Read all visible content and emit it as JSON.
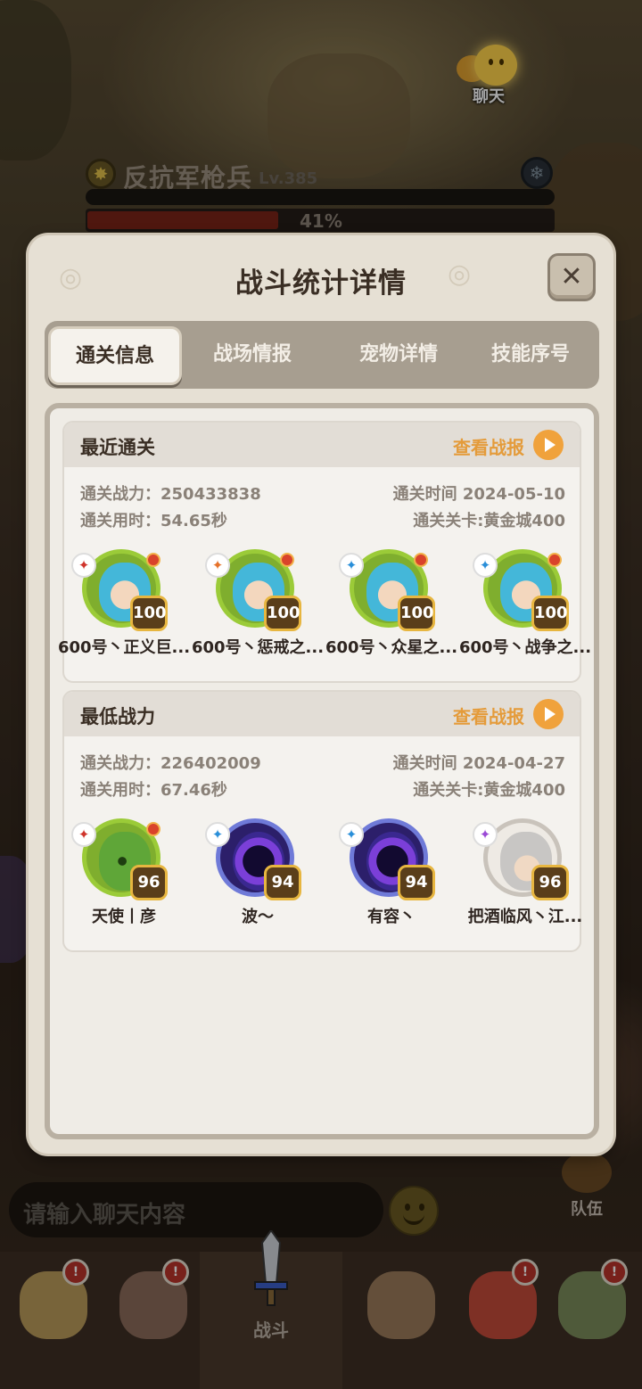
{
  "hud": {
    "chat_label": "聊天",
    "enemy_name": "反抗军枪兵",
    "enemy_level": "Lv.385",
    "enemy_hp_percent": "41%",
    "enemy_hp_fraction": 0.41,
    "chat_placeholder": "请输入聊天内容",
    "team_label": "队伍"
  },
  "bottom_nav": {
    "active_label": "战斗"
  },
  "modal": {
    "title": "战斗统计详情",
    "close_icon": "close-icon",
    "tabs": [
      {
        "label": "通关信息",
        "active": true
      },
      {
        "label": "战场情报",
        "active": false
      },
      {
        "label": "宠物详情",
        "active": false
      },
      {
        "label": "技能序号",
        "active": false
      }
    ]
  },
  "recent": {
    "title": "最近通关",
    "report_label": "查看战报",
    "power": "通关战力：250433838",
    "time": "通关时间  2024-05-10",
    "duration": "通关用时：54.65秒",
    "stage": "通关关卡:黄金城400",
    "heroes": [
      {
        "name": "600号丶正义巨...",
        "level": "100",
        "element": "red"
      },
      {
        "name": "600号丶惩戒之...",
        "level": "100",
        "element": "orange"
      },
      {
        "name": "600号丶众星之...",
        "level": "100",
        "element": "blue"
      },
      {
        "name": "600号丶战争之...",
        "level": "100",
        "element": "blue"
      }
    ]
  },
  "lowest": {
    "title": "最低战力",
    "report_label": "查看战报",
    "power": "通关战力：226402009",
    "time": "通关时间  2024-04-27",
    "duration": "通关用时：67.46秒",
    "stage": "通关关卡:黄金城400",
    "heroes": [
      {
        "name": "天使丨彦",
        "level": "96",
        "element": "red"
      },
      {
        "name": "波～",
        "level": "94",
        "element": "blue"
      },
      {
        "name": "有容丶",
        "level": "94",
        "element": "blue"
      },
      {
        "name": "把酒临风丶江...",
        "level": "96",
        "element": "purple"
      }
    ]
  }
}
